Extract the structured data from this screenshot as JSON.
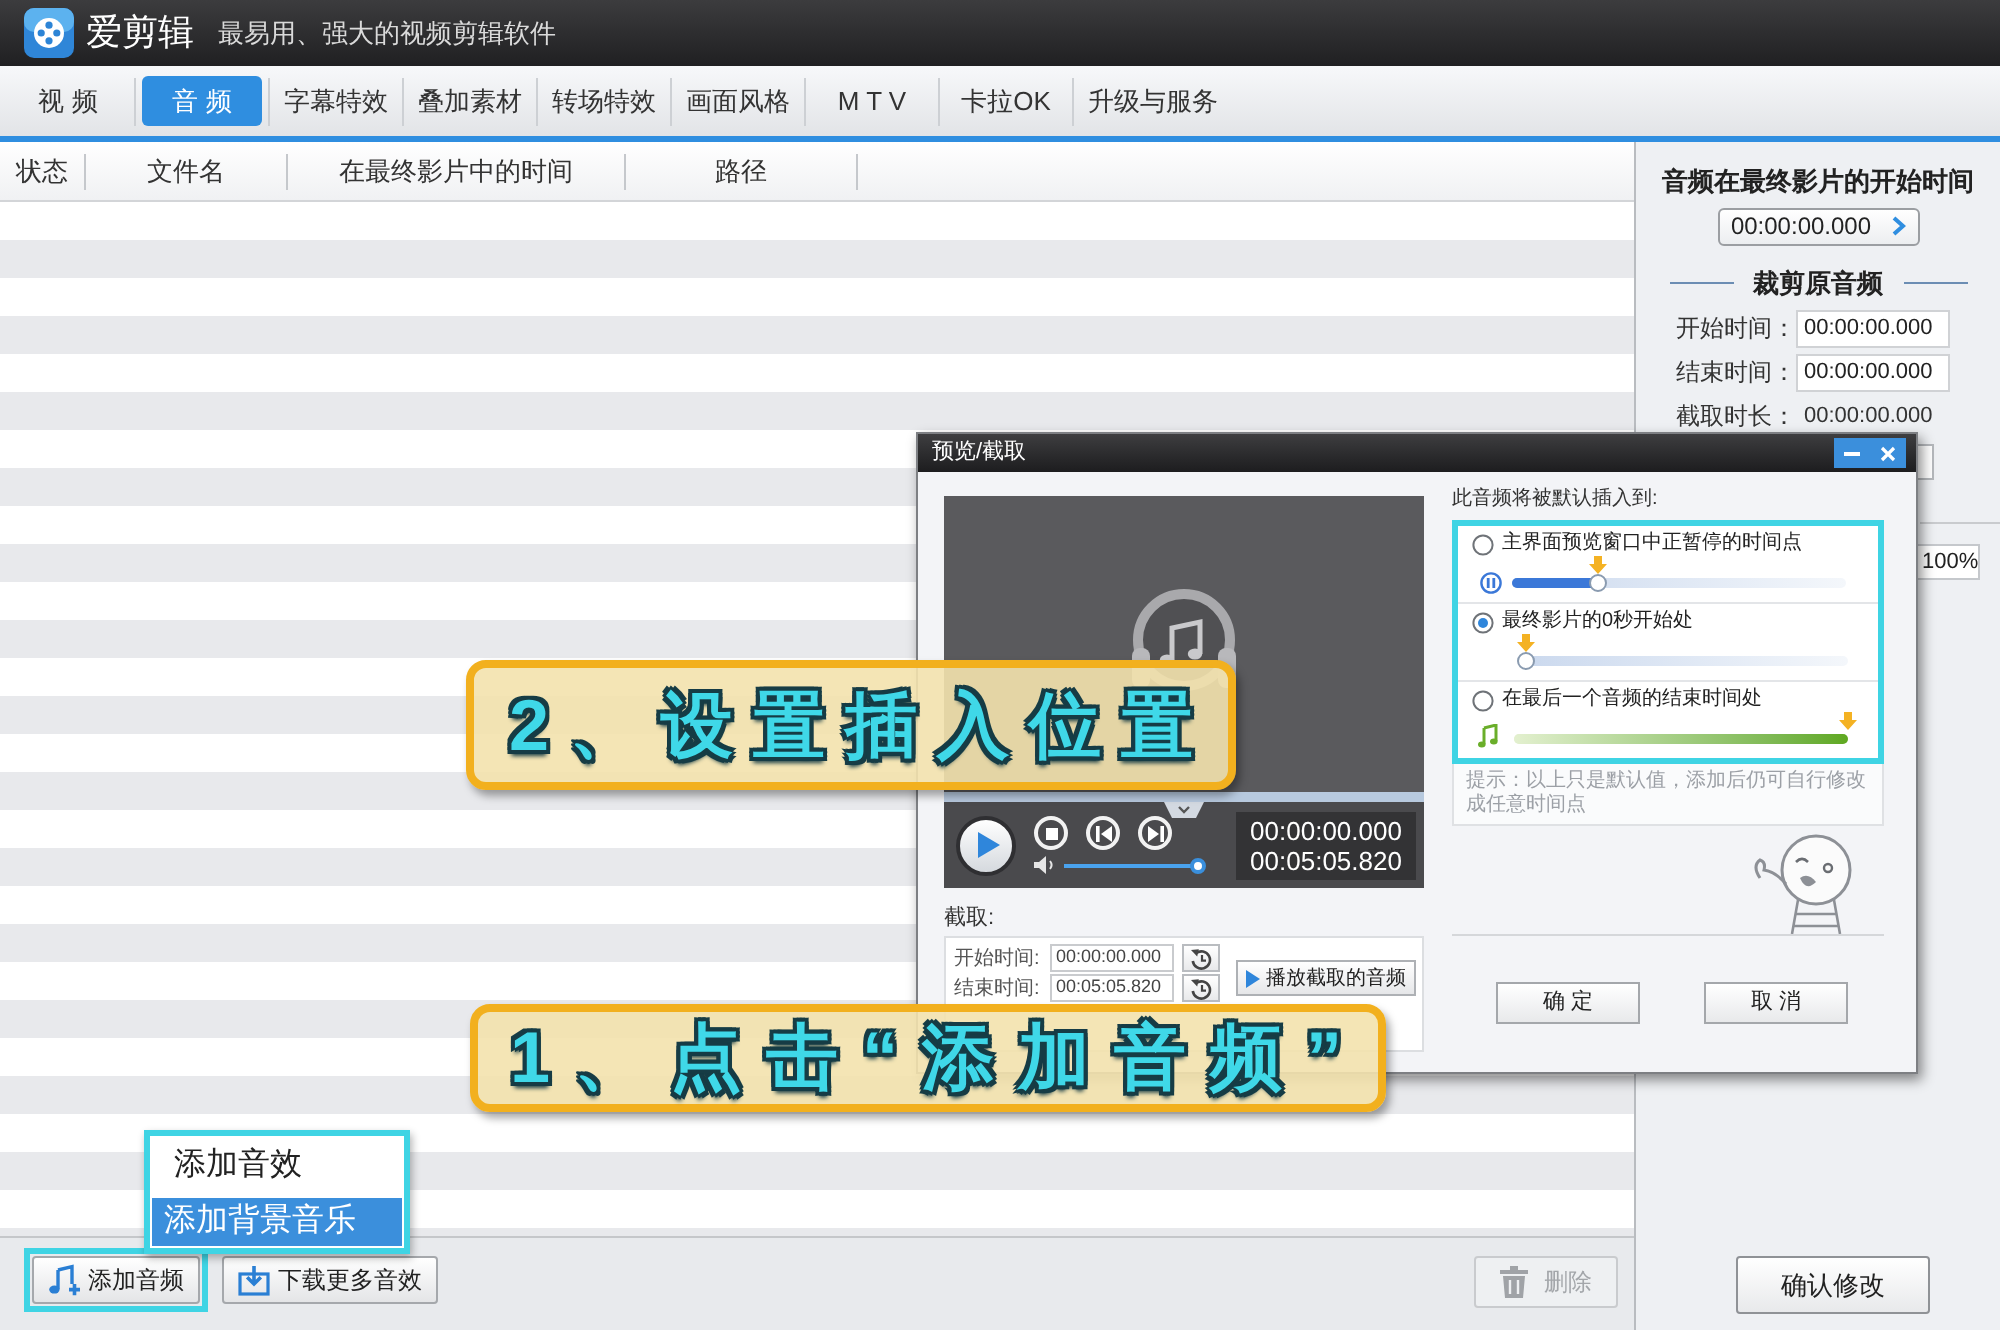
{
  "app": {
    "name": "爱剪辑",
    "slogan": "最易用、强大的视频剪辑软件"
  },
  "tabs": [
    {
      "label": "视 频",
      "selected": false
    },
    {
      "label": "音 频",
      "selected": true
    },
    {
      "label": "字幕特效",
      "selected": false
    },
    {
      "label": "叠加素材",
      "selected": false
    },
    {
      "label": "转场特效",
      "selected": false
    },
    {
      "label": "画面风格",
      "selected": false
    },
    {
      "label": "M T V",
      "selected": false
    },
    {
      "label": "卡拉OK",
      "selected": false
    },
    {
      "label": "升级与服务",
      "selected": false
    }
  ],
  "table": {
    "columns": [
      "状态",
      "文件名",
      "在最终影片中的时间",
      "路径"
    ]
  },
  "bottom_bar": {
    "buttons": [
      {
        "label": "添加音频",
        "kind": "add",
        "disabled": false,
        "highlighted": true
      },
      {
        "label": "下载更多音效",
        "kind": "download",
        "disabled": false,
        "highlighted": false
      },
      {
        "label": "删除",
        "kind": "delete",
        "disabled": true,
        "highlighted": false
      }
    ]
  },
  "popup_menu": {
    "items": [
      {
        "label": "添加音效",
        "selected": false
      },
      {
        "label": "添加背景音乐",
        "selected": true
      }
    ]
  },
  "right_panel": {
    "start_title": "音频在最终影片的开始时间",
    "start_time": "00:00:00.000",
    "trim_title": "裁剪原音频",
    "fields": [
      {
        "label": "开始时间：",
        "value": "00:00:00.000",
        "kind": "input"
      },
      {
        "label": "结束时间：",
        "value": "00:00:00.000",
        "kind": "input"
      },
      {
        "label": "截取时长：",
        "value": "00:00:00.000",
        "kind": "text"
      }
    ],
    "volume": "100%",
    "confirm_button": "确认修改"
  },
  "dialog": {
    "title": "预览/截取",
    "player": {
      "current_time": "00:00:00.000",
      "total_time": "00:05:05.820",
      "volume": {
        "level": 0.96
      }
    },
    "trim": {
      "title": "截取:",
      "rows": [
        {
          "label": "开始时间:",
          "value": "00:00:00.000"
        },
        {
          "label": "结束时间:",
          "value": "00:05:05.820"
        }
      ],
      "play_button": "播放截取的音频"
    },
    "insert": {
      "title": "此音频将被默认插入到:",
      "options": [
        {
          "label": "主界面预览窗口中正暂停的时间点",
          "selected": false,
          "kind": "pause",
          "level": 0.26
        },
        {
          "label": "最终影片的0秒开始处",
          "selected": true,
          "kind": "start",
          "level": 0
        },
        {
          "label": "在最后一个音频的结束时间处",
          "selected": false,
          "kind": "end",
          "level": 1
        }
      ],
      "hint": "提示：以上只是默认值，添加后仍可自行修改成任意时间点"
    },
    "buttons": [
      "确 定",
      "取 消"
    ]
  },
  "annotations": [
    {
      "text": "2、设置插入位置"
    },
    {
      "text": "1、点击“添加音频”"
    }
  ]
}
